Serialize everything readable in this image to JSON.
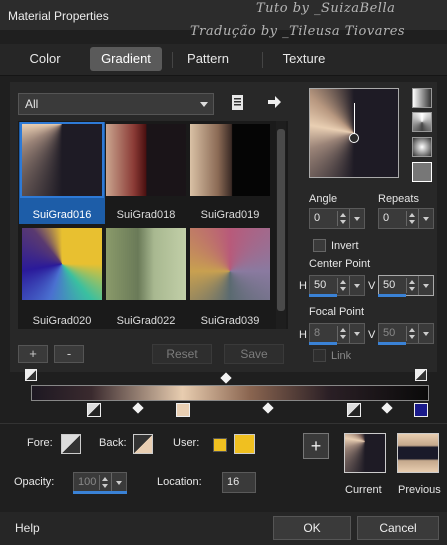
{
  "window": {
    "title": "Material Properties"
  },
  "watermark": {
    "line1": "Tuto by _SuizaBella",
    "line2": "Tradução by _Tileusa Tiovares"
  },
  "tabs": [
    {
      "label": "Color",
      "active": false
    },
    {
      "label": "Gradient",
      "active": true
    },
    {
      "label": "Pattern",
      "active": false
    },
    {
      "label": "Texture",
      "active": false
    }
  ],
  "library": {
    "filter": "All",
    "items": [
      {
        "label": "SuiGrad016",
        "selected": true
      },
      {
        "label": "SuiGrad018",
        "selected": false
      },
      {
        "label": "SuiGrad019",
        "selected": false
      },
      {
        "label": "SuiGrad020",
        "selected": false
      },
      {
        "label": "SuiGrad022",
        "selected": false
      },
      {
        "label": "SuiGrad039",
        "selected": false
      }
    ],
    "add": "+",
    "remove": "-",
    "reset": "Reset",
    "save": "Save"
  },
  "angle": {
    "label": "Angle",
    "value": "0"
  },
  "repeats": {
    "label": "Repeats",
    "value": "0"
  },
  "invert": {
    "label": "Invert",
    "checked": false
  },
  "center_point": {
    "label": "Center Point",
    "h_label": "H",
    "h": "50",
    "v_label": "V",
    "v": "50"
  },
  "focal_point": {
    "label": "Focal Point",
    "h_label": "H",
    "h": "8",
    "v_label": "V",
    "v": "50"
  },
  "link": {
    "label": "Link"
  },
  "stops": {
    "fore_label": "Fore:",
    "back_label": "Back:",
    "user_label": "User:",
    "opacity_label": "Opacity:",
    "opacity": "100",
    "location_label": "Location:",
    "location": "16",
    "user_color": "#f0c020"
  },
  "swatches": {
    "add": "+",
    "current": "Current",
    "previous": "Previous"
  },
  "footer": {
    "help": "Help",
    "ok": "OK",
    "cancel": "Cancel"
  },
  "colors": {
    "accent": "#3a82d6",
    "selection": "#1d5da8"
  }
}
